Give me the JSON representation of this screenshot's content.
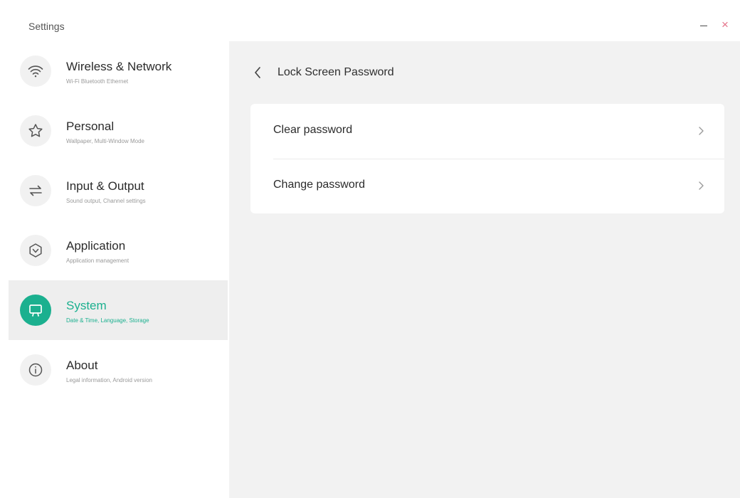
{
  "window": {
    "title": "Settings",
    "minimize_glyph": "–",
    "close_glyph": "×"
  },
  "sidebar": {
    "items": [
      {
        "label": "Wireless & Network",
        "sub": "Wi-Fi Bluetooth Ethernet",
        "icon": "wifi-icon",
        "active": false
      },
      {
        "label": "Personal",
        "sub": "Wallpaper, Multi-Window Mode",
        "icon": "star-icon",
        "active": false
      },
      {
        "label": "Input & Output",
        "sub": "Sound output, Channel settings",
        "icon": "swap-arrows-icon",
        "active": false
      },
      {
        "label": "Application",
        "sub": "Application management",
        "icon": "application-hexagon-icon",
        "active": false
      },
      {
        "label": "System",
        "sub": "Date & Time, Language, Storage",
        "icon": "monitor-icon",
        "active": true
      },
      {
        "label": "About",
        "sub": "Legal information, Android version",
        "icon": "info-icon",
        "active": false
      }
    ]
  },
  "main": {
    "title": "Lock Screen Password",
    "back_icon": "chevron-left-icon",
    "options": [
      {
        "label": "Clear password",
        "icon": "chevron-right-icon"
      },
      {
        "label": "Change password",
        "icon": "chevron-right-icon"
      }
    ]
  },
  "colors": {
    "accent": "#1bb08f",
    "close": "#e5738a",
    "active_row_bg": "#eeeeee",
    "content_bg": "#f2f2f2"
  }
}
